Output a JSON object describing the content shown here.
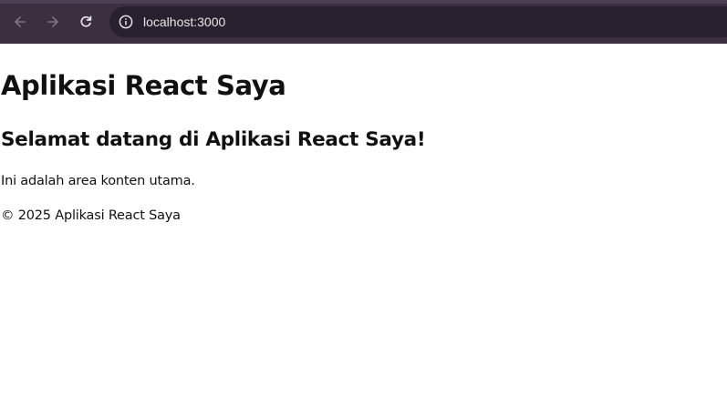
{
  "browser": {
    "url": "localhost:3000",
    "icons": {
      "back": "arrow-left-icon",
      "forward": "arrow-right-icon",
      "reload": "reload-icon",
      "site_info": "info-icon"
    },
    "colors": {
      "toolbar": "#3a3040",
      "omnibox": "#28202e",
      "url_text": "#e8e4ea"
    }
  },
  "page": {
    "title": "Aplikasi React Saya",
    "welcome_heading": "Selamat datang di Aplikasi React Saya!",
    "main_text": "Ini adalah area konten utama.",
    "footer": "© 2025 Aplikasi React Saya"
  }
}
